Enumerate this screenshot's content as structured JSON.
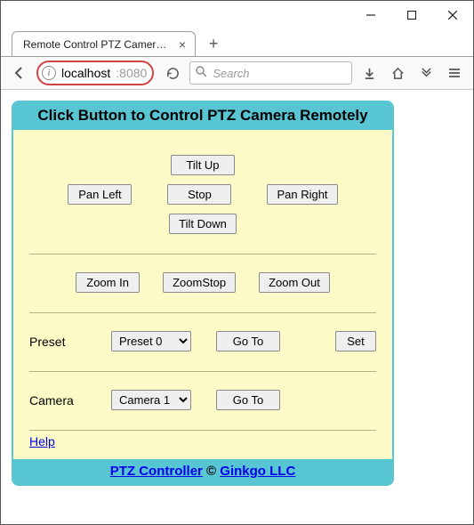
{
  "browser": {
    "tab_title": "Remote Control PTZ Camera ...",
    "url_host": "localhost",
    "url_port": ":8080",
    "search_placeholder": "Search"
  },
  "panel": {
    "header": "Click Button to Control PTZ Camera Remotely",
    "tilt_up": "Tilt Up",
    "pan_left": "Pan Left",
    "stop": "Stop",
    "pan_right": "Pan Right",
    "tilt_down": "Tilt Down",
    "zoom_in": "Zoom In",
    "zoom_stop": "ZoomStop",
    "zoom_out": "Zoom Out",
    "preset_label": "Preset",
    "preset_selected": "Preset 0",
    "goto": "Go To",
    "set": "Set",
    "camera_label": "Camera",
    "camera_selected": "Camera 1",
    "help": "Help",
    "footer_app": "PTZ Controller",
    "footer_copy": "©",
    "footer_company": "Ginkgo LLC"
  }
}
